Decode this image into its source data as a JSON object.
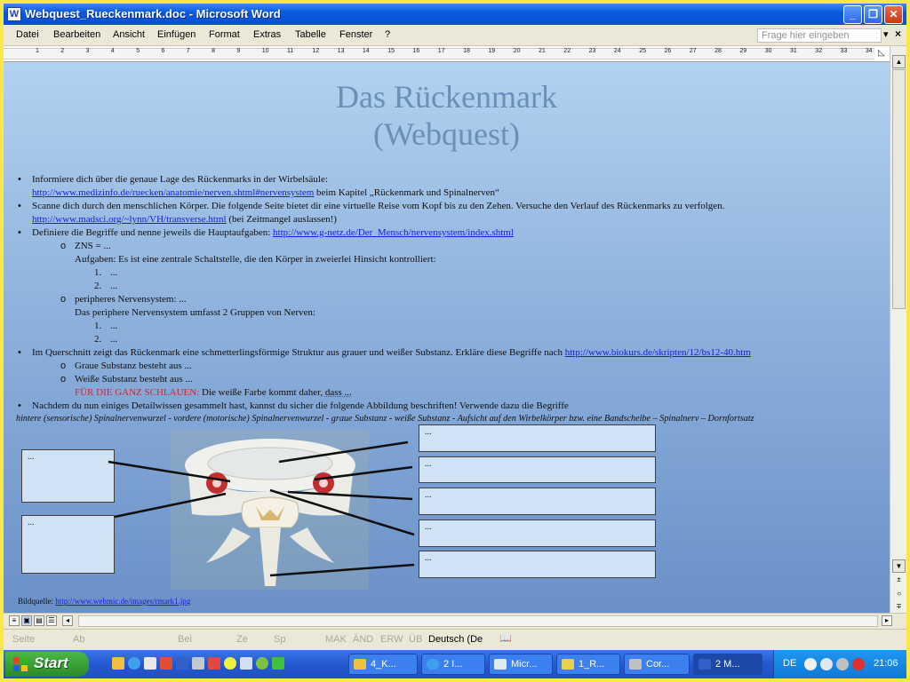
{
  "window": {
    "title": "Webquest_Rueckenmark.doc - Microsoft Word",
    "app_icon": "W",
    "controls": {
      "minimize": "_",
      "maximize": "❐",
      "close": "✕"
    }
  },
  "menu": {
    "items": [
      "Datei",
      "Bearbeiten",
      "Ansicht",
      "Einfügen",
      "Format",
      "Extras",
      "Tabelle",
      "Fenster",
      "?"
    ],
    "help_placeholder": "Frage hier eingeben",
    "help_arrow": "▾",
    "close_doc": "×"
  },
  "ruler": {
    "numbers": [
      "1",
      "2",
      "3",
      "4",
      "5",
      "6",
      "7",
      "8",
      "9",
      "10",
      "11",
      "12",
      "13",
      "14",
      "15",
      "16",
      "17",
      "18",
      "19",
      "20",
      "21",
      "22",
      "23",
      "24",
      "25",
      "26",
      "27",
      "28",
      "29",
      "30",
      "31",
      "32",
      "33",
      "34"
    ]
  },
  "document": {
    "title_line1": "Das Rückenmark",
    "title_line2": "(Webquest)",
    "bullet1_text": "Informiere dich über die genaue Lage des Rückenmarks in der Wirbelsäule:",
    "bullet1_link": "http://www.medizinfo.de/ruecken/anatomie/nerven.shtml#nervensystem",
    "bullet1_after": " beim Kapitel „Rückenmark und Spinalnerven“",
    "bullet2_text": "Scanne dich durch den menschlichen Körper. Die folgende Seite bietet dir eine virtuelle Reise vom Kopf bis zu den Zehen. Versuche den Verlauf des Rückenmarks zu verfolgen.",
    "bullet2_link": "http://www.madsci.org/~lynn/VH/transverse.html",
    "bullet2_after": " (bei Zeitmangel auslassen!)",
    "bullet3_text": "Definiere die Begriffe und nenne jeweils die Hauptaufgaben: ",
    "bullet3_link": "http://www.g-netz.de/Der_Mensch/nervensystem/index.shtml",
    "zns": "ZNS = ...",
    "zns_tasks": "Aufgaben: Es ist eine zentrale Schaltstelle, die den Körper in zweierlei Hinsicht kontrolliert:",
    "list_n1": "1.",
    "list_n2": "2.",
    "list_item": "...",
    "pns": "peripheres Nervensystem: ...",
    "pns_groups": "Das periphere Nervensystem umfasst 2 Gruppen von Nerven:",
    "bullet4_text": "Im Querschnitt zeigt das Rückenmark eine schmetterlingsförmige Struktur aus grauer und weißer Substanz. Erkläre diese Begriffe nach ",
    "bullet4_link": "http://www.biokurs.de/skripten/12/bs12-40.htm",
    "grey": "Graue Substanz besteht aus ...",
    "white": "Weiße Substanz besteht aus ...",
    "smart_red": "FÜR DIE GANZ SCHLAUEN:",
    "smart_text": " Die weiße Farbe kommt daher, ",
    "smart_dass": "dass ...",
    "bullet5_text": "Nachdem du nun einiges Detailwissen gesammelt hast, kannst du sicher die folgende Abbildung beschriften! Verwende dazu die Begriffe",
    "terms": "hintere (sensorische) Spinalnervenwurzel - vordere (motorische) Spinalnervenwurzel - graue Substanz - weiße Substanz - Aufsicht auf den Wirbelkörper bzw. eine Bandscheibe – Spinalnerv – Dornfortsatz",
    "label_placeholder": "...",
    "source_label": "Bildquelle: ",
    "source_link": "http://www.webmic.de/images/rmark1.jpg"
  },
  "status": {
    "seite": "Seite",
    "ab": "Ab",
    "bei": "Bei",
    "ze": "Ze",
    "sp": "Sp",
    "mak": "MAK",
    "aend": "ÄND",
    "erw": "ERW",
    "ueb": "ÜB",
    "language": "Deutsch (De",
    "book_icon": "📖"
  },
  "taskbar": {
    "start": "Start",
    "buttons": [
      "4_K...",
      "2 I...",
      "Micr...",
      "1_R...",
      "Cor...",
      "2 M..."
    ],
    "tray_lang": "DE",
    "time": "21:06"
  },
  "colors": {
    "titlebar": "#0a5ae0",
    "link": "#1a1ae8",
    "accent_red": "#e02020",
    "doc_title": "#6a8fb8"
  }
}
